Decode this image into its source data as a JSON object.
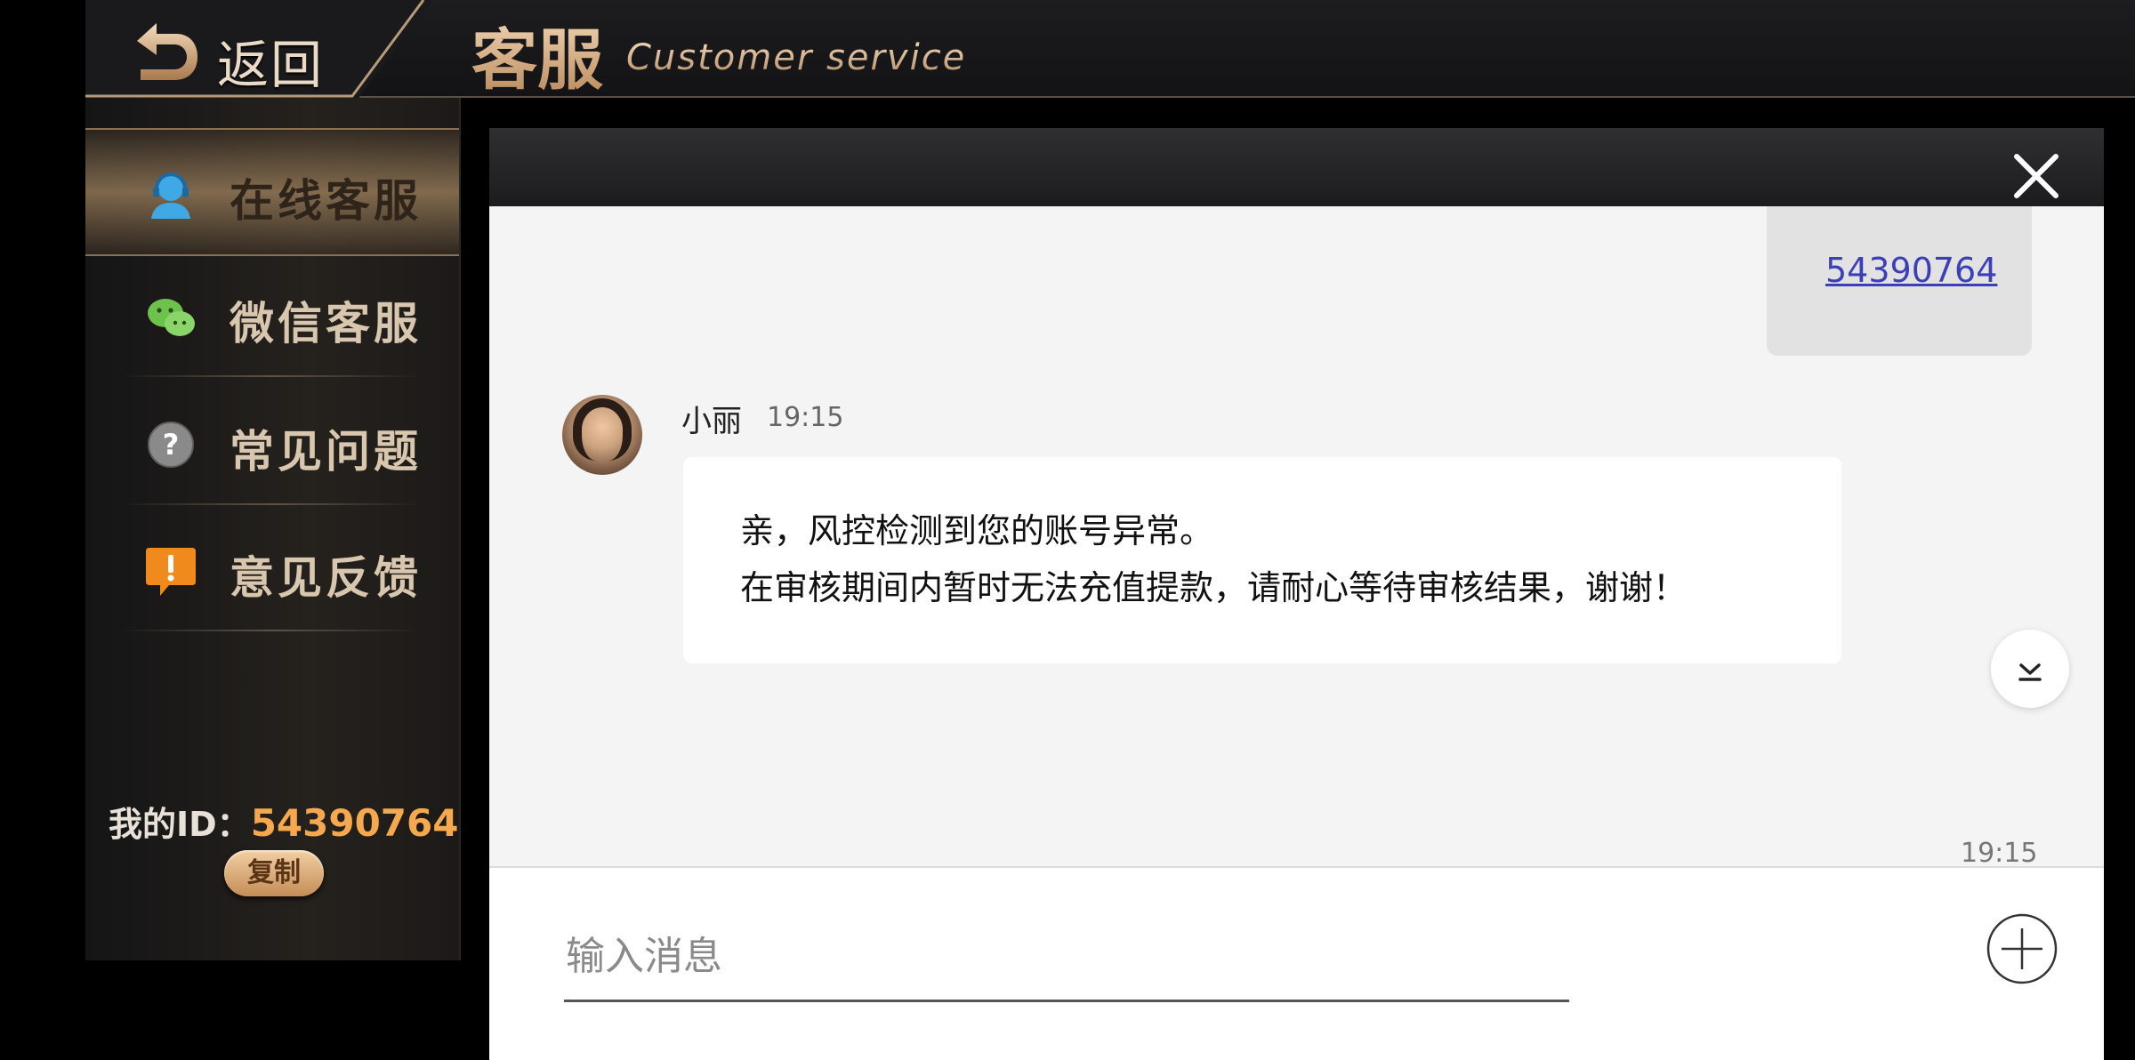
{
  "header": {
    "back_label": "返回",
    "title_cn": "客服",
    "title_en": "Customer service"
  },
  "sidebar": {
    "items": [
      {
        "label": "在线客服",
        "icon": "support-agent-icon",
        "active": true
      },
      {
        "label": "微信客服",
        "icon": "wechat-icon",
        "active": false
      },
      {
        "label": "常见问题",
        "icon": "question-icon",
        "active": false
      },
      {
        "label": "意见反馈",
        "icon": "feedback-icon",
        "active": false
      }
    ],
    "my_id_label": "我的ID：",
    "my_id_value": "54390764",
    "copy_label": "复制"
  },
  "chat": {
    "sent_message": "54390764",
    "agent_name": "小丽",
    "agent_time": "19:15",
    "agent_message_lines": [
      "亲，风控检测到您的账号异常。",
      "在审核期间内暂时无法充值提款，请耐心等待审核结果，谢谢！"
    ],
    "last_time": "19:15",
    "input_placeholder": "输入消息"
  },
  "colors": {
    "accent_gold": "#d9ad82",
    "id_orange": "#f5a84d",
    "link_blue": "#3d3fb8"
  }
}
